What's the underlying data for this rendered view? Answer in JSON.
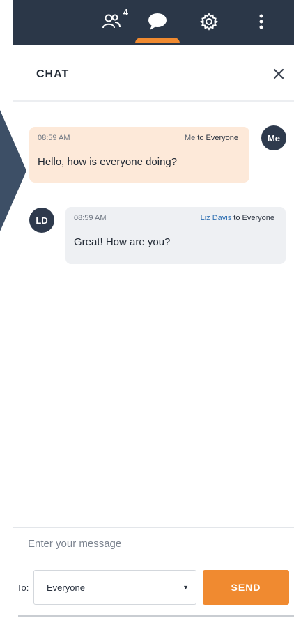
{
  "topbar": {
    "participants_count": "4",
    "icons": [
      "participants-icon",
      "chat-icon",
      "gear-icon",
      "more-vertical-icon"
    ],
    "accent_color": "#f08a30",
    "background_color": "#2b3748"
  },
  "header": {
    "title": "CHAT",
    "close_icon": "close-icon"
  },
  "messages": [
    {
      "time": "08:59 AM",
      "sender": "Me",
      "to_text": "to Everyone",
      "text": "Hello, how is everyone doing?",
      "avatar": "Me",
      "bubble_color": "#fde9d9"
    },
    {
      "time": "08:59 AM",
      "sender": "Liz Davis",
      "to_text": "to Everyone",
      "text": "Great! How are you?",
      "avatar": "LD",
      "bubble_color": "#eef0f3"
    }
  ],
  "composer": {
    "placeholder": "Enter your message",
    "to_label": "To:",
    "recipient": "Everyone",
    "send_label": "SEND"
  }
}
